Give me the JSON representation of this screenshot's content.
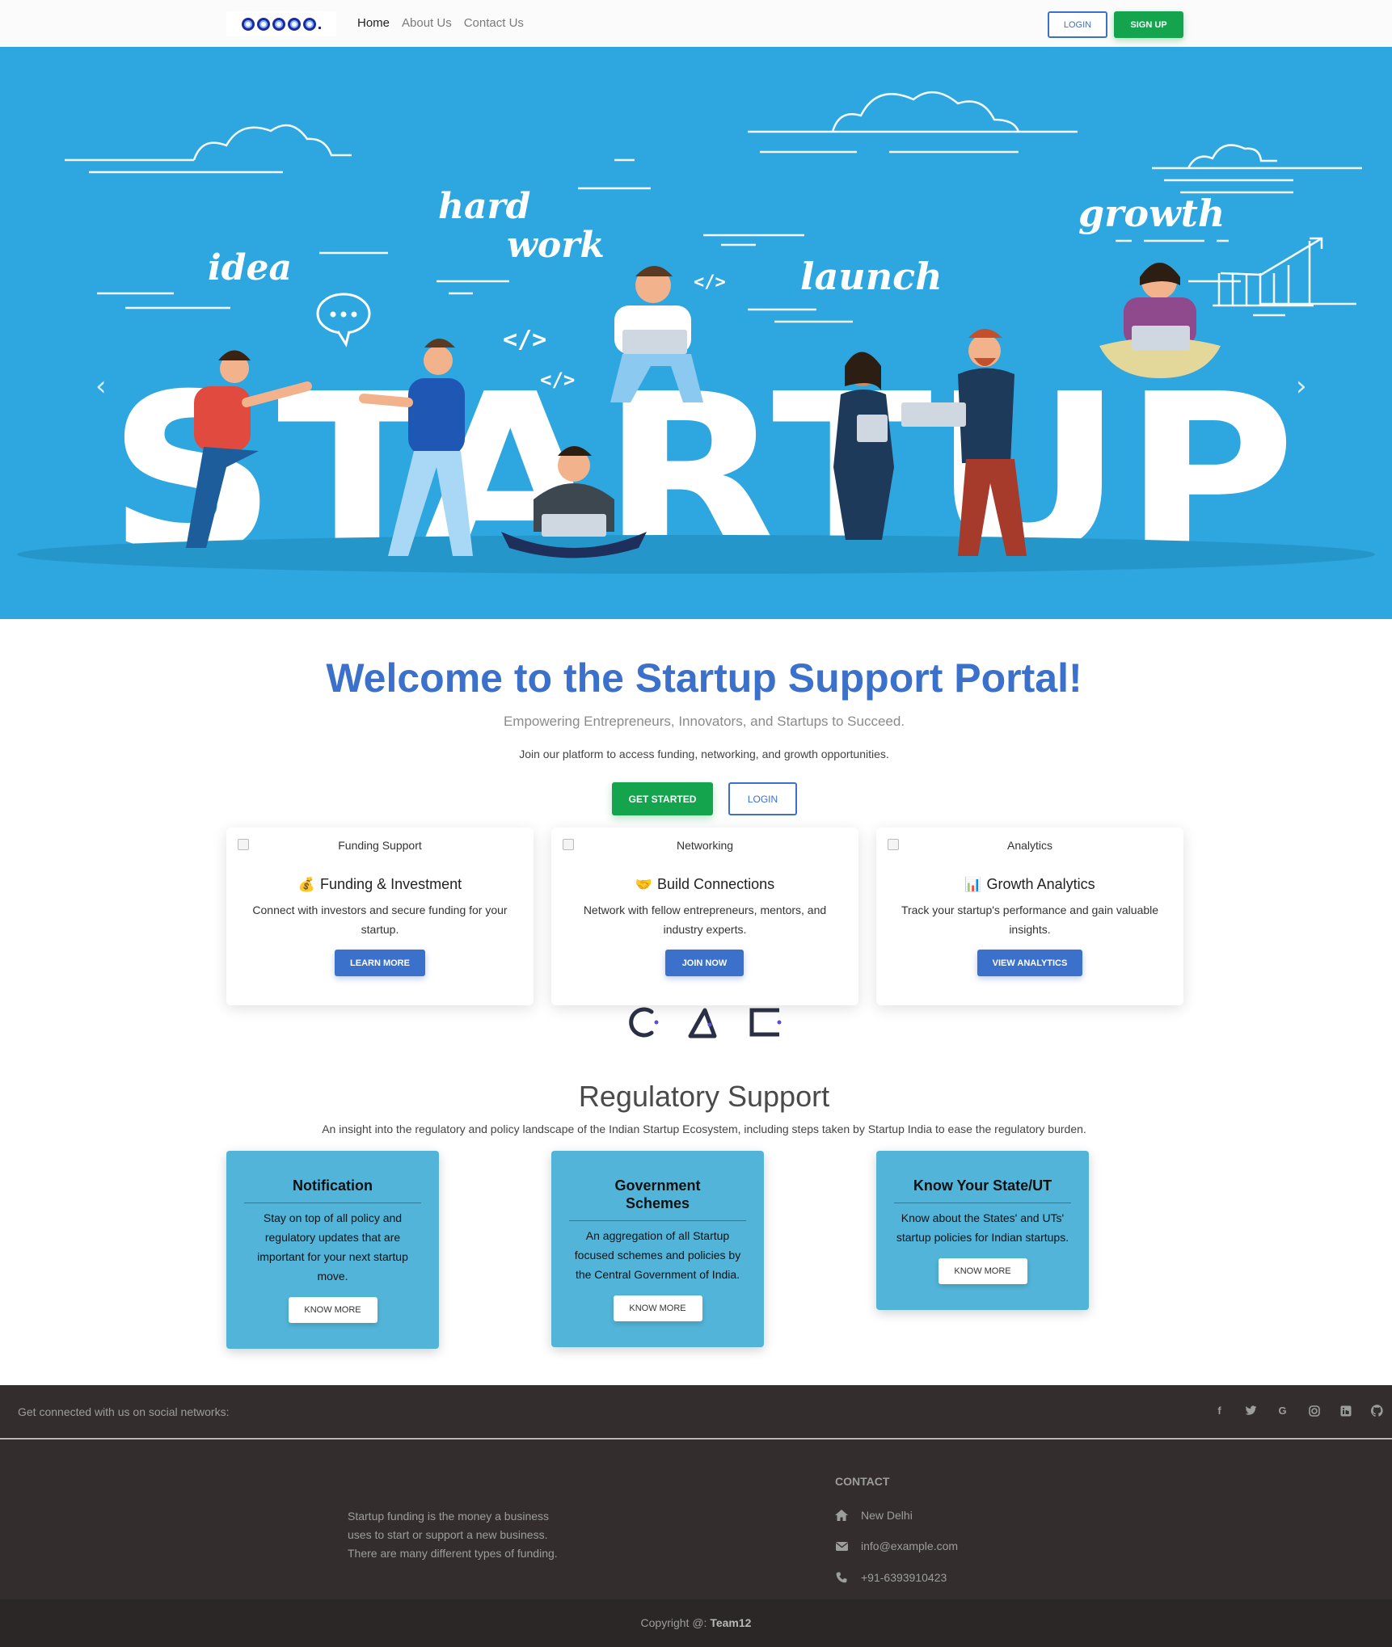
{
  "navbar": {
    "links": [
      {
        "label": "Home",
        "active": true
      },
      {
        "label": "About Us",
        "active": false
      },
      {
        "label": "Contact Us",
        "active": false
      }
    ],
    "login_label": "LOGIN",
    "signup_label": "SIGN UP"
  },
  "hero": {
    "words": [
      "hard",
      "work",
      "idea",
      "launch",
      "growth"
    ],
    "big_text": "STARTUP",
    "code_tag": "</>",
    "colors": {
      "background": "#2ea6df",
      "text": "#ffffff"
    }
  },
  "welcome": {
    "title": "Welcome to the Startup Support Portal!",
    "subtitle": "Empowering Entrepreneurs, Innovators, and Startups to Succeed.",
    "description": "Join our platform to access funding, networking, and growth opportunities.",
    "get_started_label": "GET STARTED",
    "login_label": "LOGIN"
  },
  "features": [
    {
      "image_alt": "Funding Support",
      "icon": "💰",
      "title": "Funding & Investment",
      "text": "Connect with investors and secure funding for your startup.",
      "button": "LEARN MORE"
    },
    {
      "image_alt": "Networking",
      "icon": "🤝",
      "title": "Build Connections",
      "text": "Network with fellow entrepreneurs, mentors, and industry experts.",
      "button": "JOIN NOW"
    },
    {
      "image_alt": "Analytics",
      "icon": "📊",
      "title": "Growth Analytics",
      "text": "Track your startup's performance and gain valuable insights.",
      "button": "VIEW ANALYTICS"
    }
  ],
  "regulatory": {
    "title": "Regulatory Support",
    "description": "An insight into the regulatory and policy landscape of the Indian Startup Ecosystem, including steps taken by Startup India to ease the regulatory burden.",
    "cards": [
      {
        "title": "Notification",
        "text": "Stay on top of all policy and regulatory updates that are important for your next startup move.",
        "button": "KNOW MORE"
      },
      {
        "title": "Government Schemes",
        "text": "An aggregation of all Startup focused schemes and policies by the Central Government of India.",
        "button": "KNOW MORE"
      },
      {
        "title": "Know Your State/UT",
        "text": "Know about the States' and UTs' startup policies for Indian startups.",
        "button": "KNOW MORE"
      }
    ]
  },
  "footer": {
    "social_text": "Get connected with us on social networks:",
    "social_icons": [
      "facebook-icon",
      "twitter-icon",
      "google-icon",
      "instagram-icon",
      "linkedin-icon",
      "github-icon"
    ],
    "about": "Startup funding is the money a business uses to start or support a new business. There are many different types of funding.",
    "contact_heading": "CONTACT",
    "contact": {
      "address": "New Delhi",
      "email": "info@example.com",
      "phone": "+91-6393910423"
    },
    "copyright_prefix": "Copyright @: ",
    "copyright_team": "Team12"
  },
  "colors": {
    "primary": "#3b71ca",
    "success": "#14a44d",
    "footer_bg": "#332d2d",
    "reg_card": "#52b4d8"
  }
}
